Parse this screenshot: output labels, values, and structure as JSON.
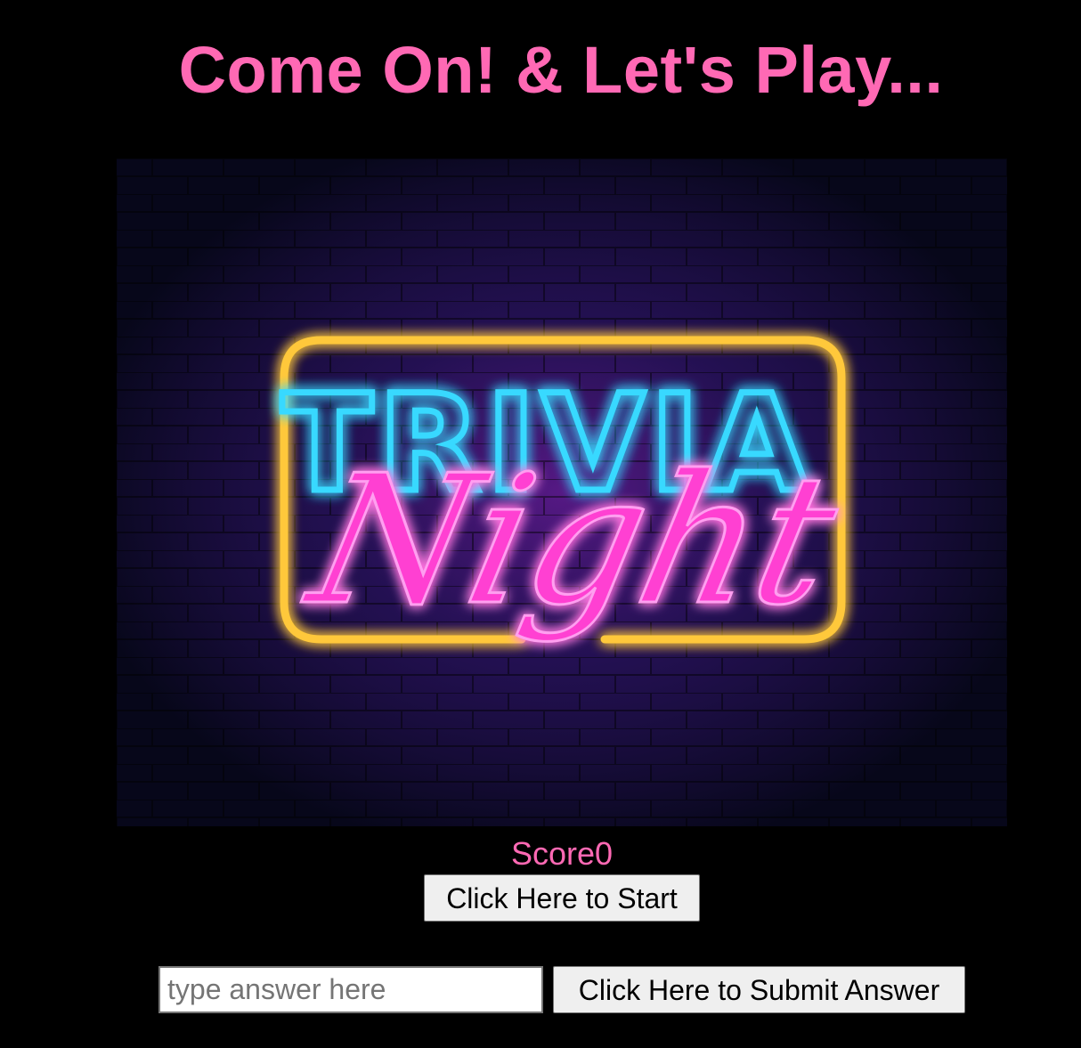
{
  "header": {
    "title": "Come On! & Let's Play..."
  },
  "hero": {
    "sign_top": "TRIVIA",
    "sign_bottom": "Night",
    "colors": {
      "wall": "#0a0a1e",
      "frame": "#ffc83a",
      "trivia": "#38d9ff",
      "night": "#ff3fd2"
    }
  },
  "score": {
    "label": "Score",
    "value": "0"
  },
  "controls": {
    "start_label": "Click Here to Start",
    "answer_placeholder": "type answer here",
    "submit_label": "Click Here to Submit Answer"
  },
  "theme": {
    "accent": "#ff69b4",
    "background": "#000000"
  }
}
